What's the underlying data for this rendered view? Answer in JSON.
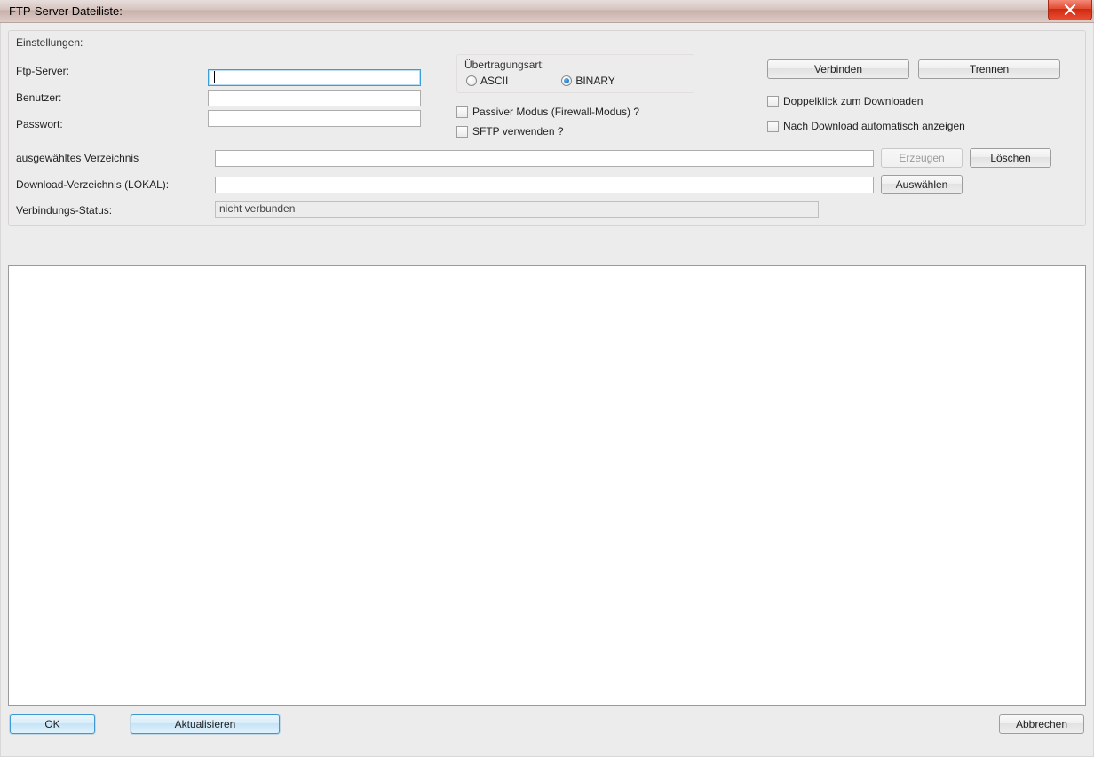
{
  "window": {
    "title": "FTP-Server Dateiliste:"
  },
  "settings": {
    "legend": "Einstellungen:",
    "labels": {
      "ftp_server": "Ftp-Server:",
      "user": "Benutzer:",
      "password": "Passwort:",
      "selected_dir": "ausgewähltes Verzeichnis",
      "download_dir": "Download-Verzeichnis (LOKAL):",
      "conn_status": "Verbindungs-Status:"
    },
    "values": {
      "ftp_server": "",
      "user": "",
      "password": "",
      "selected_dir": "",
      "download_dir": "",
      "conn_status": "nicht verbunden"
    },
    "transfer": {
      "caption": "Übertragungsart:",
      "ascii": "ASCII",
      "binary": "BINARY",
      "selected": "binary"
    },
    "options": {
      "passive": "Passiver Modus (Firewall-Modus) ?",
      "sftp": "SFTP verwenden ?",
      "dbl_download": "Doppelklick zum Downloaden",
      "auto_show": "Nach Download automatisch anzeigen"
    },
    "buttons": {
      "connect": "Verbinden",
      "disconnect": "Trennen",
      "create": "Erzeugen",
      "delete": "Löschen",
      "choose": "Auswählen"
    }
  },
  "bottom": {
    "ok": "OK",
    "refresh": "Aktualisieren",
    "cancel": "Abbrechen"
  }
}
